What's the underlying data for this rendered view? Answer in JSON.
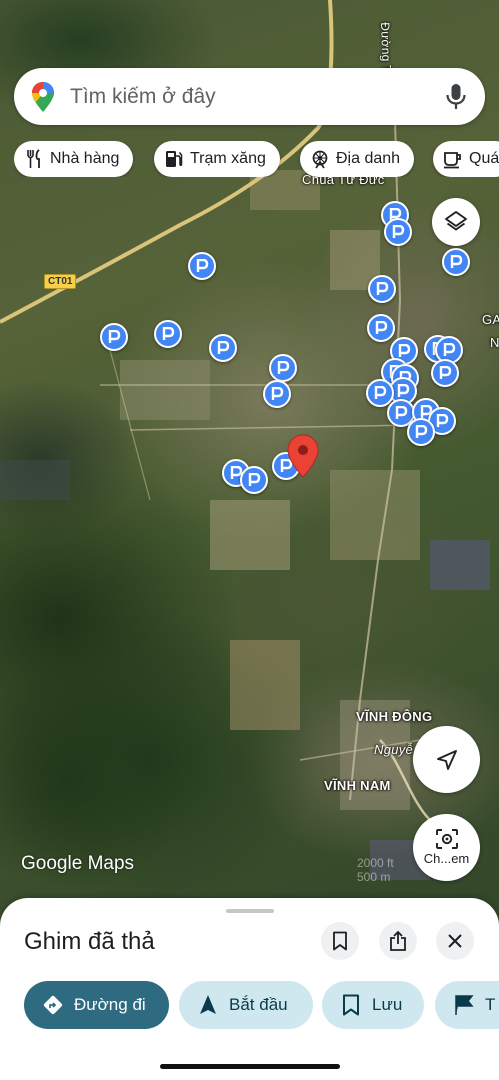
{
  "search": {
    "placeholder": "Tìm kiếm ở đây"
  },
  "chips": [
    {
      "label": "Nhà hàng",
      "icon": "restaurant-icon"
    },
    {
      "label": "Trạm xăng",
      "icon": "gas-station-icon"
    },
    {
      "label": "Địa danh",
      "icon": "attraction-icon"
    },
    {
      "label": "Quá",
      "icon": "coffee-icon"
    }
  ],
  "map": {
    "labels": {
      "chua_tu_duc": "Chùa Từ Đức",
      "road_ct01": "CT01",
      "vinh_dong": "VĨNH ĐÔNG",
      "vinh_nam": "VĨNH NAM",
      "nguyen": "Nguyễ",
      "street_top": "Đường Thống",
      "edge_a": "GA",
      "edge_n": "N"
    },
    "scale": "2000 ft\n500 m",
    "brand": {
      "google": "Google",
      "maps": "Maps"
    },
    "colors": {
      "pin_blue": "#4285f4",
      "dropped_pin_red": "#ea4335",
      "road_yellow": "#f7d04a"
    }
  },
  "lens_button": {
    "label": "Ch...em"
  },
  "sheet": {
    "title": "Ghim đã thả",
    "actions": [
      {
        "label": "Đường đi",
        "icon": "directions-icon"
      },
      {
        "label": "Bắt đầu",
        "icon": "navigation-icon"
      },
      {
        "label": "Lưu",
        "icon": "bookmark-icon"
      },
      {
        "label": "T",
        "icon": "flag-icon"
      }
    ],
    "colors": {
      "primary": "#2f6b80",
      "secondary": "#cfe8f0"
    }
  }
}
